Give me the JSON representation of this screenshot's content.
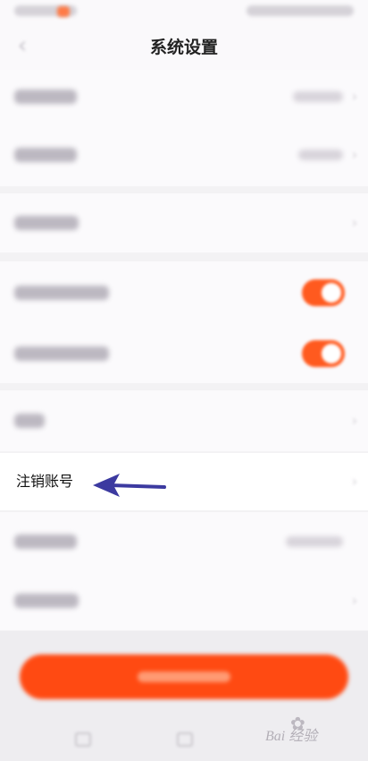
{
  "header": {
    "title": "系统设置"
  },
  "rows": {
    "cancel_account": {
      "label": "注销账号"
    }
  },
  "colors": {
    "accent": "#ff5a1f",
    "arrow": "#3c3aa0",
    "background": "#f3f2f4"
  },
  "icons": {
    "back": "chevron-left-icon",
    "chevron": "chevron-right-icon",
    "arrow": "arrow-left-icon"
  },
  "watermark": {
    "text": "Bai 经验"
  }
}
